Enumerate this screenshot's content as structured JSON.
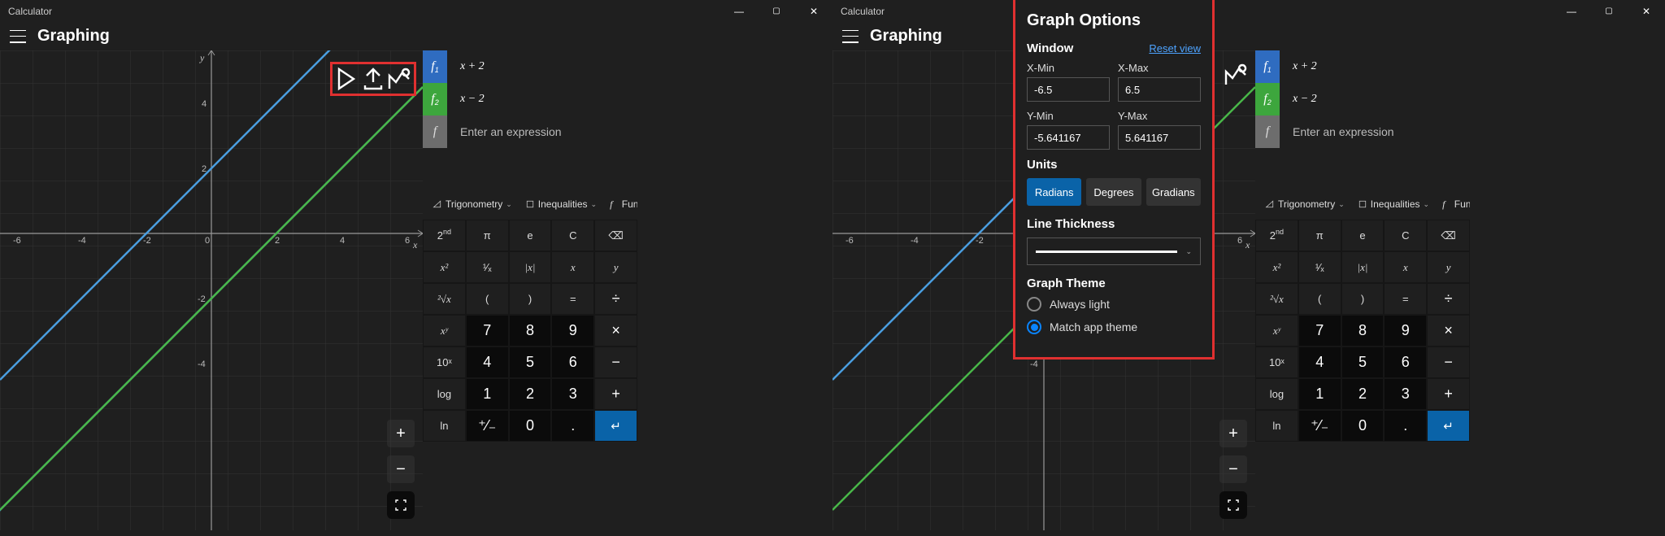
{
  "app_title": "Calculator",
  "page_title": "Graphing",
  "window_controls": {
    "min": "—",
    "max": "▢",
    "close": "✕"
  },
  "equations": [
    {
      "chip": "f",
      "sub": "1",
      "text": "x + 2",
      "chipClass": "chip-blue"
    },
    {
      "chip": "f",
      "sub": "2",
      "text": "x − 2",
      "chipClass": "chip-green"
    }
  ],
  "equation_placeholder": "Enter an expression",
  "categories": {
    "trig": "Trigonometry",
    "ineq": "Inequalities",
    "func": "Funct"
  },
  "keys_row1": [
    "2",
    "π",
    "e",
    "C",
    "⌫"
  ],
  "keys_row1_sup": "nd",
  "keys_row2": [
    "x²",
    "¹⁄ₓ",
    "|x|",
    "x",
    "y"
  ],
  "keys_row3": [
    "²√x",
    "(",
    ")",
    "=",
    "÷"
  ],
  "keys_row4": [
    "xʸ",
    "7",
    "8",
    "9",
    "×"
  ],
  "keys_row5": [
    "10ˣ",
    "4",
    "5",
    "6",
    "−"
  ],
  "keys_row6": [
    "log",
    "1",
    "2",
    "3",
    "+"
  ],
  "keys_row7": [
    "ln",
    "⁺⁄₋",
    "0",
    ".",
    "↵"
  ],
  "axis": {
    "x_ticks": [
      "-6",
      "-4",
      "-2",
      "0",
      "2",
      "4",
      "6"
    ],
    "y_ticks_pos": [
      "2",
      "4"
    ],
    "y_ticks_neg": [
      "-2",
      "-4"
    ],
    "x_label": "x",
    "y_label": "y"
  },
  "zoom": {
    "plus": "+",
    "minus": "−"
  },
  "graph_options": {
    "title": "Graph Options",
    "window_label": "Window",
    "reset": "Reset view",
    "xmin_label": "X-Min",
    "xmin": "-6.5",
    "xmax_label": "X-Max",
    "xmax": "6.5",
    "ymin_label": "Y-Min",
    "ymin": "-5.641167",
    "ymax_label": "Y-Max",
    "ymax": "5.641167",
    "units_label": "Units",
    "units": [
      "Radians",
      "Degrees",
      "Gradians"
    ],
    "thickness_label": "Line Thickness",
    "theme_label": "Graph Theme",
    "theme_opts": [
      "Always light",
      "Match app theme"
    ]
  },
  "chart_data": {
    "type": "line",
    "title": "",
    "xlabel": "x",
    "ylabel": "y",
    "xlim": [
      -6.5,
      6.5
    ],
    "ylim": [
      -5.641167,
      5.641167
    ],
    "series": [
      {
        "name": "f1 = x + 2",
        "color": "#4a9ee0",
        "x": [
          -6.5,
          6.5
        ],
        "y": [
          -4.5,
          8.5
        ]
      },
      {
        "name": "f2 = x - 2",
        "color": "#49b749",
        "x": [
          -6.5,
          6.5
        ],
        "y": [
          -8.5,
          4.5
        ]
      }
    ]
  }
}
